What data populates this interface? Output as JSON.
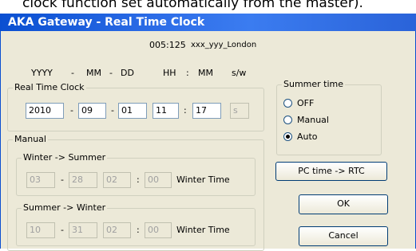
{
  "caption": "clock function set automatically from the master).",
  "window": {
    "title": "AKA Gateway - Real Time Clock"
  },
  "device": {
    "id": "005:125",
    "name": "xxx_yyy_London"
  },
  "format_header": {
    "yyyy": "YYYY",
    "mm": "MM",
    "dd": "DD",
    "hh": "HH",
    "min": "MM",
    "sw": "s/w"
  },
  "separators": {
    "dash": "-",
    "colon": ":"
  },
  "rtc": {
    "label": "Real Time Clock",
    "year": "2010",
    "month": "09",
    "day": "01",
    "hour": "11",
    "minute": "17",
    "sw": "s"
  },
  "summer_time": {
    "label": "Summer time",
    "options": [
      "OFF",
      "Manual",
      "Auto"
    ],
    "selected": "Auto"
  },
  "manual": {
    "label": "Manual",
    "winter_to_summer": {
      "label": "Winter -> Summer",
      "month": "03",
      "day": "28",
      "hour": "02",
      "minute": "00",
      "time_label": "Winter Time"
    },
    "summer_to_winter": {
      "label": "Summer -> Winter",
      "month": "10",
      "day": "31",
      "hour": "02",
      "minute": "00",
      "time_label": "Winter Time"
    }
  },
  "buttons": {
    "pc_to_rtc": "PC time -> RTC",
    "ok": "OK",
    "cancel": "Cancel"
  },
  "colors": {
    "title_bar": "#2e6ee8",
    "dialog_bg": "#ece9d8",
    "field_border": "#7f9db9"
  }
}
